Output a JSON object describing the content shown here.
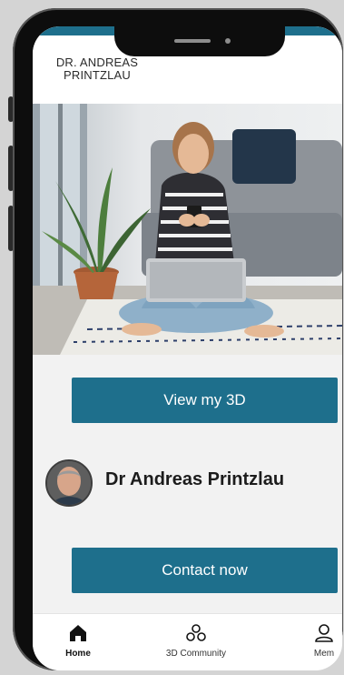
{
  "header": {
    "logo_line1": "DR. ANDREAS",
    "logo_line2": "PRINTZLAU"
  },
  "colors": {
    "accent": "#1e6f8c",
    "background": "#f2f2f2"
  },
  "main": {
    "view_3d_label": "View my 3D",
    "doctor_name": "Dr Andreas Printzlau",
    "contact_label": "Contact now"
  },
  "tabbar": {
    "items": [
      {
        "label": "Home",
        "icon": "home-icon",
        "active": true
      },
      {
        "label": "3D Community",
        "icon": "community-icon",
        "active": false
      },
      {
        "label": "Mem",
        "icon": "profile-icon",
        "active": false
      }
    ]
  }
}
